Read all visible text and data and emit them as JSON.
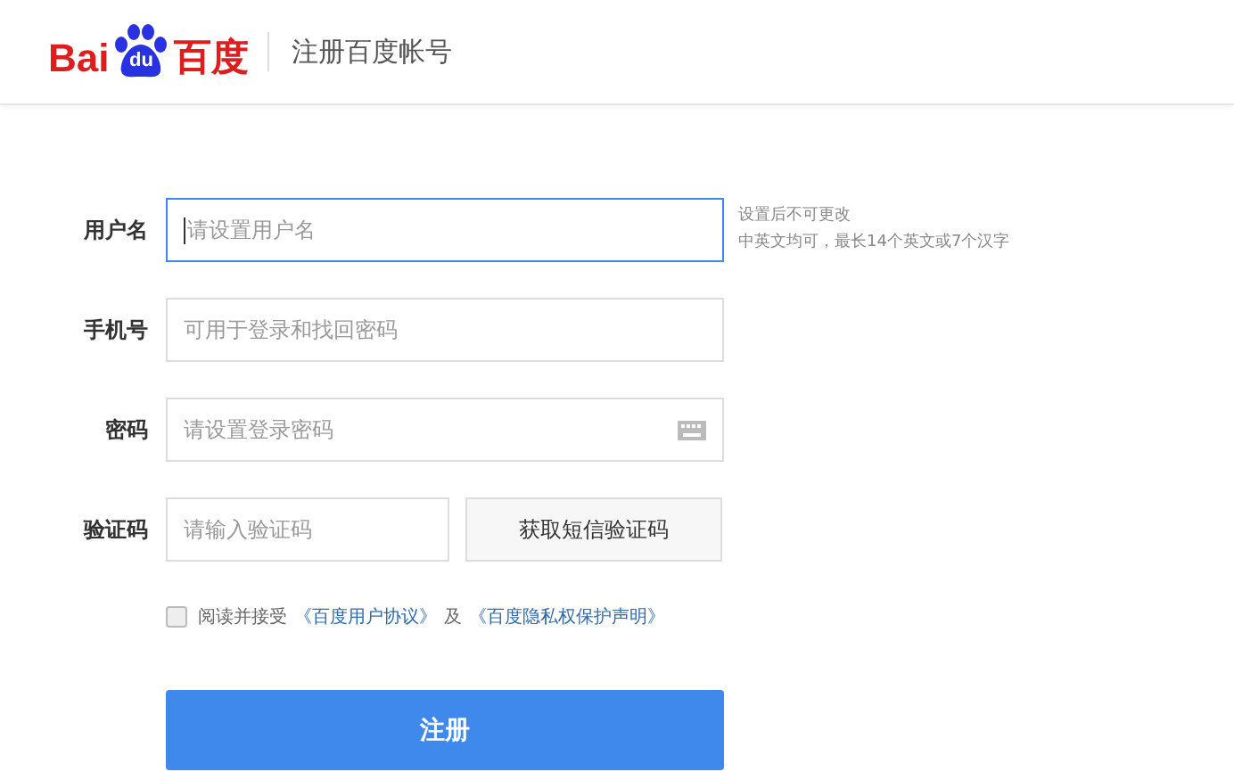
{
  "header": {
    "logo": {
      "left": "Bai",
      "paw": "du",
      "right": "百度"
    },
    "title": "注册百度帐号"
  },
  "fields": [
    {
      "kind": "text",
      "label": "用户名",
      "placeholder": "请设置用户名",
      "focused": true,
      "hint": [
        "设置后不可更改",
        "中英文均可，最长14个英文或7个汉字"
      ]
    },
    {
      "kind": "text",
      "label": "手机号",
      "placeholder": "可用于登录和找回密码",
      "focused": false
    },
    {
      "kind": "password",
      "label": "密码",
      "placeholder": "请设置登录密码",
      "focused": false
    },
    {
      "kind": "code",
      "label": "验证码",
      "placeholder": "请输入验证码",
      "focused": false,
      "button": "获取短信验证码"
    }
  ],
  "agreement": {
    "checked": false,
    "text": "阅读并接受",
    "link1": "《百度用户协议》",
    "joiner": "及",
    "link2": "《百度隐私权保护声明》"
  },
  "submit": "注册"
}
